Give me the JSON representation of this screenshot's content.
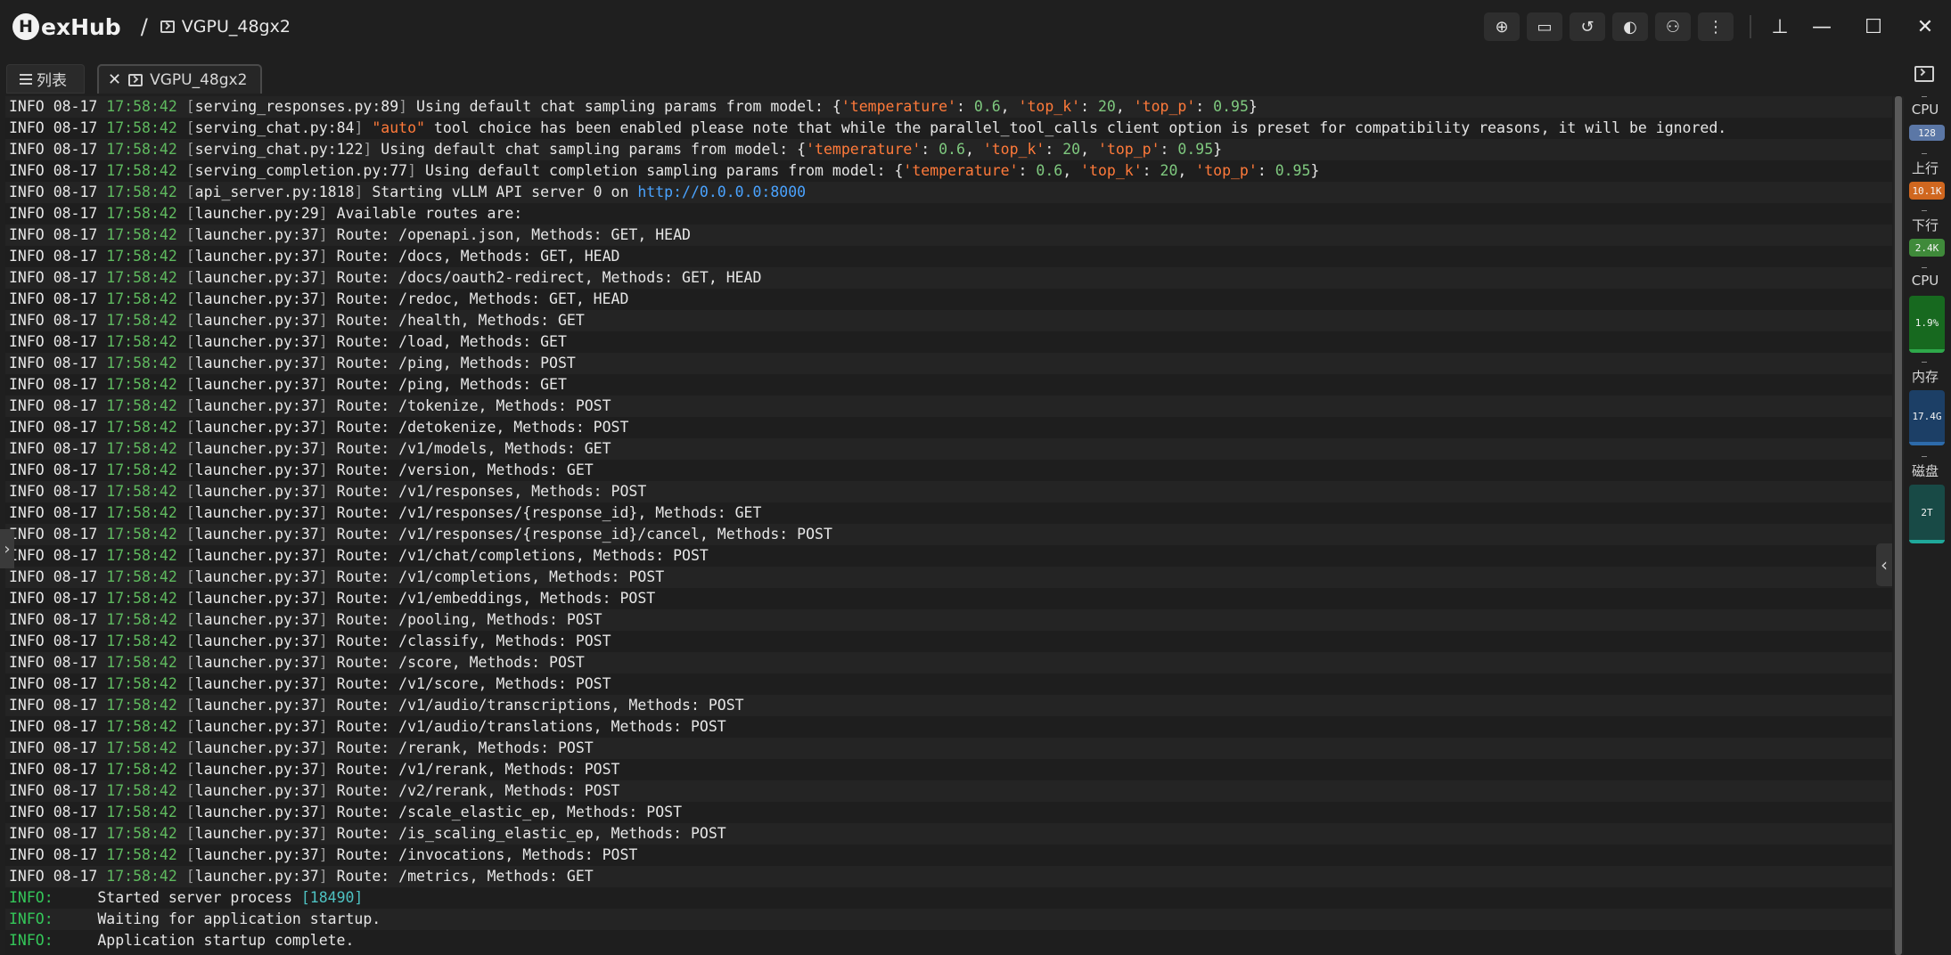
{
  "app": {
    "logo_letter": "H",
    "logo_text": "exHub",
    "separator": "/",
    "host_name": "VGPU_48gx2"
  },
  "toolbar": {
    "buttons": [
      {
        "name": "download-icon",
        "glyph": "⊕"
      },
      {
        "name": "monitor-icon",
        "glyph": "▭"
      },
      {
        "name": "history-icon",
        "glyph": "↺"
      },
      {
        "name": "theme-icon",
        "glyph": "◐"
      },
      {
        "name": "user-settings-icon",
        "glyph": "⚇"
      },
      {
        "name": "more-icon",
        "glyph": "⋮"
      }
    ],
    "pin_glyph": "⊥",
    "minimize_glyph": "—",
    "maximize_glyph": "☐",
    "close_glyph": "✕"
  },
  "tabs": {
    "list_label": "列表",
    "host_label": "VGPU_48gx2",
    "close_glyph": "✕"
  },
  "colors": {
    "accent_green": "#5fb95f",
    "string_orange": "#ff7a3a",
    "url_blue": "#4aa3ff"
  },
  "monitor": {
    "cpu_label": "CPU",
    "cpu_value": "128",
    "up_label": "上行",
    "up_value": "10.1K",
    "down_label": "下行",
    "down_value": "2.4K",
    "cpu_usage_label": "CPU",
    "cpu_usage_value": "1.9%",
    "mem_label": "内存",
    "mem_value": "17.4G",
    "disk_label": "磁盘",
    "disk_value": "2T"
  },
  "log": {
    "level": "INFO",
    "date": "08-17",
    "time": "17:58:42",
    "entries": [
      {
        "src": "serving_responses.py:89",
        "kind": "params",
        "text": " Using default chat sampling params from model: ",
        "params": [
          "0.6",
          "20",
          "0.95"
        ]
      },
      {
        "src": "serving_chat.py:84",
        "kind": "auto",
        "text": " tool choice has been enabled please note that while the parallel_tool_calls client option is preset for compatibility reasons, it will be ignored.",
        "auto": "\"auto\""
      },
      {
        "src": "serving_chat.py:122",
        "kind": "params",
        "text": " Using default chat sampling params from model: ",
        "params": [
          "0.6",
          "20",
          "0.95"
        ]
      },
      {
        "src": "serving_completion.py:77",
        "kind": "params",
        "text": " Using default completion sampling params from model: ",
        "params": [
          "0.6",
          "20",
          "0.95"
        ]
      },
      {
        "src": "api_server.py:1818",
        "kind": "url",
        "text": " Starting vLLM API server 0 on ",
        "url": "http://0.0.0.0:8000"
      },
      {
        "src": "launcher.py:29",
        "kind": "plain",
        "text": " Available routes are:"
      },
      {
        "src": "launcher.py:37",
        "kind": "plain",
        "text": " Route: /openapi.json, Methods: GET, HEAD"
      },
      {
        "src": "launcher.py:37",
        "kind": "plain",
        "text": " Route: /docs, Methods: GET, HEAD"
      },
      {
        "src": "launcher.py:37",
        "kind": "plain",
        "text": " Route: /docs/oauth2-redirect, Methods: GET, HEAD"
      },
      {
        "src": "launcher.py:37",
        "kind": "plain",
        "text": " Route: /redoc, Methods: GET, HEAD"
      },
      {
        "src": "launcher.py:37",
        "kind": "plain",
        "text": " Route: /health, Methods: GET"
      },
      {
        "src": "launcher.py:37",
        "kind": "plain",
        "text": " Route: /load, Methods: GET"
      },
      {
        "src": "launcher.py:37",
        "kind": "plain",
        "text": " Route: /ping, Methods: POST"
      },
      {
        "src": "launcher.py:37",
        "kind": "plain",
        "text": " Route: /ping, Methods: GET"
      },
      {
        "src": "launcher.py:37",
        "kind": "plain",
        "text": " Route: /tokenize, Methods: POST"
      },
      {
        "src": "launcher.py:37",
        "kind": "plain",
        "text": " Route: /detokenize, Methods: POST"
      },
      {
        "src": "launcher.py:37",
        "kind": "plain",
        "text": " Route: /v1/models, Methods: GET"
      },
      {
        "src": "launcher.py:37",
        "kind": "plain",
        "text": " Route: /version, Methods: GET"
      },
      {
        "src": "launcher.py:37",
        "kind": "plain",
        "text": " Route: /v1/responses, Methods: POST"
      },
      {
        "src": "launcher.py:37",
        "kind": "plain",
        "text": " Route: /v1/responses/{response_id}, Methods: GET"
      },
      {
        "src": "launcher.py:37",
        "kind": "plain",
        "text": " Route: /v1/responses/{response_id}/cancel, Methods: POST"
      },
      {
        "src": "launcher.py:37",
        "kind": "plain",
        "text": " Route: /v1/chat/completions, Methods: POST"
      },
      {
        "src": "launcher.py:37",
        "kind": "plain",
        "text": " Route: /v1/completions, Methods: POST"
      },
      {
        "src": "launcher.py:37",
        "kind": "plain",
        "text": " Route: /v1/embeddings, Methods: POST"
      },
      {
        "src": "launcher.py:37",
        "kind": "plain",
        "text": " Route: /pooling, Methods: POST"
      },
      {
        "src": "launcher.py:37",
        "kind": "plain",
        "text": " Route: /classify, Methods: POST"
      },
      {
        "src": "launcher.py:37",
        "kind": "plain",
        "text": " Route: /score, Methods: POST"
      },
      {
        "src": "launcher.py:37",
        "kind": "plain",
        "text": " Route: /v1/score, Methods: POST"
      },
      {
        "src": "launcher.py:37",
        "kind": "plain",
        "text": " Route: /v1/audio/transcriptions, Methods: POST"
      },
      {
        "src": "launcher.py:37",
        "kind": "plain",
        "text": " Route: /v1/audio/translations, Methods: POST"
      },
      {
        "src": "launcher.py:37",
        "kind": "plain",
        "text": " Route: /rerank, Methods: POST"
      },
      {
        "src": "launcher.py:37",
        "kind": "plain",
        "text": " Route: /v1/rerank, Methods: POST"
      },
      {
        "src": "launcher.py:37",
        "kind": "plain",
        "text": " Route: /v2/rerank, Methods: POST"
      },
      {
        "src": "launcher.py:37",
        "kind": "plain",
        "text": " Route: /scale_elastic_ep, Methods: POST"
      },
      {
        "src": "launcher.py:37",
        "kind": "plain",
        "text": " Route: /is_scaling_elastic_ep, Methods: POST"
      },
      {
        "src": "launcher.py:37",
        "kind": "plain",
        "text": " Route: /invocations, Methods: POST"
      },
      {
        "src": "launcher.py:37",
        "kind": "plain",
        "text": " Route: /metrics, Methods: GET"
      }
    ],
    "uvicorn": [
      {
        "label": "INFO:",
        "text": "Started server process ",
        "pid": "[18490]"
      },
      {
        "label": "INFO:",
        "text": "Waiting for application startup."
      },
      {
        "label": "INFO:",
        "text": "Application startup complete."
      }
    ]
  }
}
